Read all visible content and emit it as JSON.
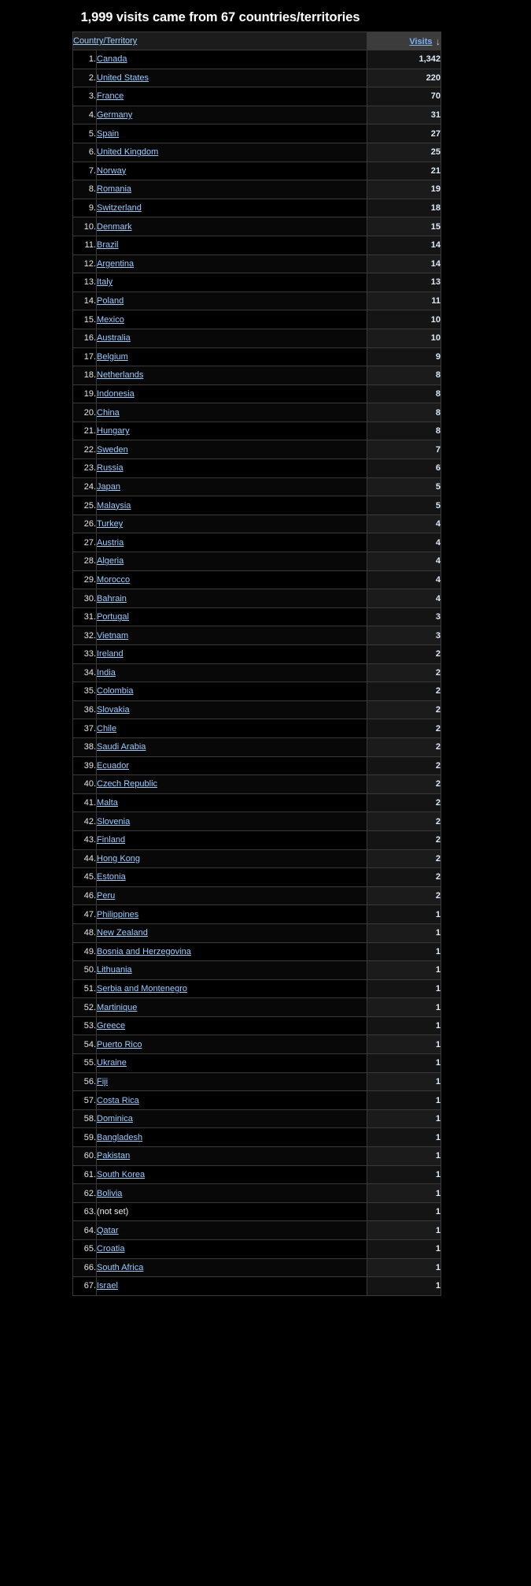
{
  "report": {
    "title": "1,999 visits came from 67 countries/territories",
    "total_visits": "1,999",
    "country_count": "67"
  },
  "table": {
    "columns": {
      "dimension_label": "Country/Territory",
      "metric_label": "Visits",
      "sort_arrow_icon": "arrow-down-icon",
      "sort_arrow_glyph": "↓",
      "sort_direction": "descending"
    },
    "colors": {
      "link": "#9ecbff",
      "metric_header_bg": "#3c3c3c",
      "dimension_header_bg": "#1c1c1c",
      "page_bg": "#000000",
      "border": "#3a3a3a",
      "value_text": "#dce9f7"
    },
    "rows": [
      {
        "index": "1.",
        "country": "Canada",
        "visits": "1,342",
        "link": true
      },
      {
        "index": "2.",
        "country": "United States",
        "visits": "220",
        "link": true
      },
      {
        "index": "3.",
        "country": "France",
        "visits": "70",
        "link": true
      },
      {
        "index": "4.",
        "country": "Germany",
        "visits": "31",
        "link": true
      },
      {
        "index": "5.",
        "country": "Spain",
        "visits": "27",
        "link": true
      },
      {
        "index": "6.",
        "country": "United Kingdom",
        "visits": "25",
        "link": true
      },
      {
        "index": "7.",
        "country": "Norway",
        "visits": "21",
        "link": true
      },
      {
        "index": "8.",
        "country": "Romania",
        "visits": "19",
        "link": true
      },
      {
        "index": "9.",
        "country": "Switzerland",
        "visits": "18",
        "link": true
      },
      {
        "index": "10.",
        "country": "Denmark",
        "visits": "15",
        "link": true
      },
      {
        "index": "11.",
        "country": "Brazil",
        "visits": "14",
        "link": true
      },
      {
        "index": "12.",
        "country": "Argentina",
        "visits": "14",
        "link": true
      },
      {
        "index": "13.",
        "country": "Italy",
        "visits": "13",
        "link": true
      },
      {
        "index": "14.",
        "country": "Poland",
        "visits": "11",
        "link": true
      },
      {
        "index": "15.",
        "country": "Mexico",
        "visits": "10",
        "link": true
      },
      {
        "index": "16.",
        "country": "Australia",
        "visits": "10",
        "link": true
      },
      {
        "index": "17.",
        "country": "Belgium",
        "visits": "9",
        "link": true
      },
      {
        "index": "18.",
        "country": "Netherlands",
        "visits": "8",
        "link": true
      },
      {
        "index": "19.",
        "country": "Indonesia",
        "visits": "8",
        "link": true
      },
      {
        "index": "20.",
        "country": "China",
        "visits": "8",
        "link": true
      },
      {
        "index": "21.",
        "country": "Hungary",
        "visits": "8",
        "link": true
      },
      {
        "index": "22.",
        "country": "Sweden",
        "visits": "7",
        "link": true
      },
      {
        "index": "23.",
        "country": "Russia",
        "visits": "6",
        "link": true
      },
      {
        "index": "24.",
        "country": "Japan",
        "visits": "5",
        "link": true
      },
      {
        "index": "25.",
        "country": "Malaysia",
        "visits": "5",
        "link": true
      },
      {
        "index": "26.",
        "country": "Turkey",
        "visits": "4",
        "link": true
      },
      {
        "index": "27.",
        "country": "Austria",
        "visits": "4",
        "link": true
      },
      {
        "index": "28.",
        "country": "Algeria",
        "visits": "4",
        "link": true
      },
      {
        "index": "29.",
        "country": "Morocco",
        "visits": "4",
        "link": true
      },
      {
        "index": "30.",
        "country": "Bahrain",
        "visits": "4",
        "link": true
      },
      {
        "index": "31.",
        "country": "Portugal",
        "visits": "3",
        "link": true
      },
      {
        "index": "32.",
        "country": "Vietnam",
        "visits": "3",
        "link": true
      },
      {
        "index": "33.",
        "country": "Ireland",
        "visits": "2",
        "link": true
      },
      {
        "index": "34.",
        "country": "India",
        "visits": "2",
        "link": true
      },
      {
        "index": "35.",
        "country": "Colombia",
        "visits": "2",
        "link": true
      },
      {
        "index": "36.",
        "country": "Slovakia",
        "visits": "2",
        "link": true
      },
      {
        "index": "37.",
        "country": "Chile",
        "visits": "2",
        "link": true
      },
      {
        "index": "38.",
        "country": "Saudi Arabia",
        "visits": "2",
        "link": true
      },
      {
        "index": "39.",
        "country": "Ecuador",
        "visits": "2",
        "link": true
      },
      {
        "index": "40.",
        "country": "Czech Republic",
        "visits": "2",
        "link": true
      },
      {
        "index": "41.",
        "country": "Malta",
        "visits": "2",
        "link": true
      },
      {
        "index": "42.",
        "country": "Slovenia",
        "visits": "2",
        "link": true
      },
      {
        "index": "43.",
        "country": "Finland",
        "visits": "2",
        "link": true
      },
      {
        "index": "44.",
        "country": "Hong Kong",
        "visits": "2",
        "link": true
      },
      {
        "index": "45.",
        "country": "Estonia",
        "visits": "2",
        "link": true
      },
      {
        "index": "46.",
        "country": "Peru",
        "visits": "2",
        "link": true
      },
      {
        "index": "47.",
        "country": "Philippines",
        "visits": "1",
        "link": true
      },
      {
        "index": "48.",
        "country": "New Zealand",
        "visits": "1",
        "link": true
      },
      {
        "index": "49.",
        "country": "Bosnia and Herzegovina",
        "visits": "1",
        "link": true
      },
      {
        "index": "50.",
        "country": "Lithuania",
        "visits": "1",
        "link": true
      },
      {
        "index": "51.",
        "country": "Serbia and Montenegro",
        "visits": "1",
        "link": true
      },
      {
        "index": "52.",
        "country": "Martinique",
        "visits": "1",
        "link": true
      },
      {
        "index": "53.",
        "country": "Greece",
        "visits": "1",
        "link": true
      },
      {
        "index": "54.",
        "country": "Puerto Rico",
        "visits": "1",
        "link": true
      },
      {
        "index": "55.",
        "country": "Ukraine",
        "visits": "1",
        "link": true
      },
      {
        "index": "56.",
        "country": "Fiji",
        "visits": "1",
        "link": true
      },
      {
        "index": "57.",
        "country": "Costa Rica",
        "visits": "1",
        "link": true
      },
      {
        "index": "58.",
        "country": "Dominica",
        "visits": "1",
        "link": true
      },
      {
        "index": "59.",
        "country": "Bangladesh",
        "visits": "1",
        "link": true
      },
      {
        "index": "60.",
        "country": "Pakistan",
        "visits": "1",
        "link": true
      },
      {
        "index": "61.",
        "country": "South Korea",
        "visits": "1",
        "link": true
      },
      {
        "index": "62.",
        "country": "Bolivia",
        "visits": "1",
        "link": true
      },
      {
        "index": "63.",
        "country": "(not set)",
        "visits": "1",
        "link": false
      },
      {
        "index": "64.",
        "country": "Qatar",
        "visits": "1",
        "link": true
      },
      {
        "index": "65.",
        "country": "Croatia",
        "visits": "1",
        "link": true
      },
      {
        "index": "66.",
        "country": "South Africa",
        "visits": "1",
        "link": true
      },
      {
        "index": "67.",
        "country": "Israel",
        "visits": "1",
        "link": true
      }
    ]
  }
}
